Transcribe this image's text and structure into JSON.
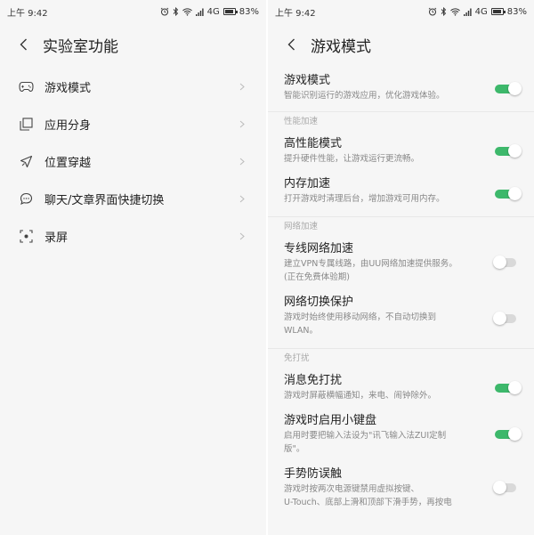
{
  "status_left": {
    "time": "上午 9:42",
    "network": "4G",
    "battery": "83%",
    "battery_level": 0.83
  },
  "status_right": {
    "time": "上午 9:42",
    "network": "4G",
    "battery": "83%",
    "battery_level": 0.83
  },
  "lab": {
    "title": "实验室功能",
    "items": [
      {
        "label": "游戏模式",
        "icon": "gamepad-icon"
      },
      {
        "label": "应用分身",
        "icon": "app-clone-icon"
      },
      {
        "label": "位置穿越",
        "icon": "location-icon"
      },
      {
        "label": "聊天/文章界面快捷切换",
        "icon": "chat-icon"
      },
      {
        "label": "录屏",
        "icon": "screen-record-icon"
      }
    ]
  },
  "game_mode": {
    "title": "游戏模式",
    "main": {
      "title": "游戏模式",
      "desc": "智能识别运行的游戏应用，优化游戏体验。",
      "on": true
    },
    "sections": [
      {
        "label": "性能加速",
        "items": [
          {
            "title": "高性能模式",
            "desc": "提升硬件性能，让游戏运行更流畅。",
            "on": true
          },
          {
            "title": "内存加速",
            "desc": "打开游戏时清理后台，增加游戏可用内存。",
            "on": true
          }
        ]
      },
      {
        "label": "网络加速",
        "items": [
          {
            "title": "专线网络加速",
            "desc": "建立VPN专属线路，由UU网络加速提供服务。",
            "desc2": "(正在免费体验期)",
            "on": false
          },
          {
            "title": "网络切换保护",
            "desc": "游戏时始终使用移动网络，不自动切换到",
            "desc2": "WLAN。",
            "on": false
          }
        ]
      },
      {
        "label": "免打扰",
        "items": [
          {
            "title": "消息免打扰",
            "desc": "游戏时屏蔽横幅通知，来电、闹钟除外。",
            "on": true
          },
          {
            "title": "游戏时启用小键盘",
            "desc": "启用时要把输入法设为\"讯飞输入法ZUI定制",
            "desc2": "版\"。",
            "on": true
          },
          {
            "title": "手势防误触",
            "desc": "游戏时按两次电源键禁用虚拟按键、",
            "desc2": "U-Touch、底部上滑和顶部下滑手势，再按电",
            "on": false
          }
        ]
      }
    ]
  },
  "colors": {
    "toggle_on": "#3db86b",
    "toggle_off": "#d9d9d9"
  }
}
